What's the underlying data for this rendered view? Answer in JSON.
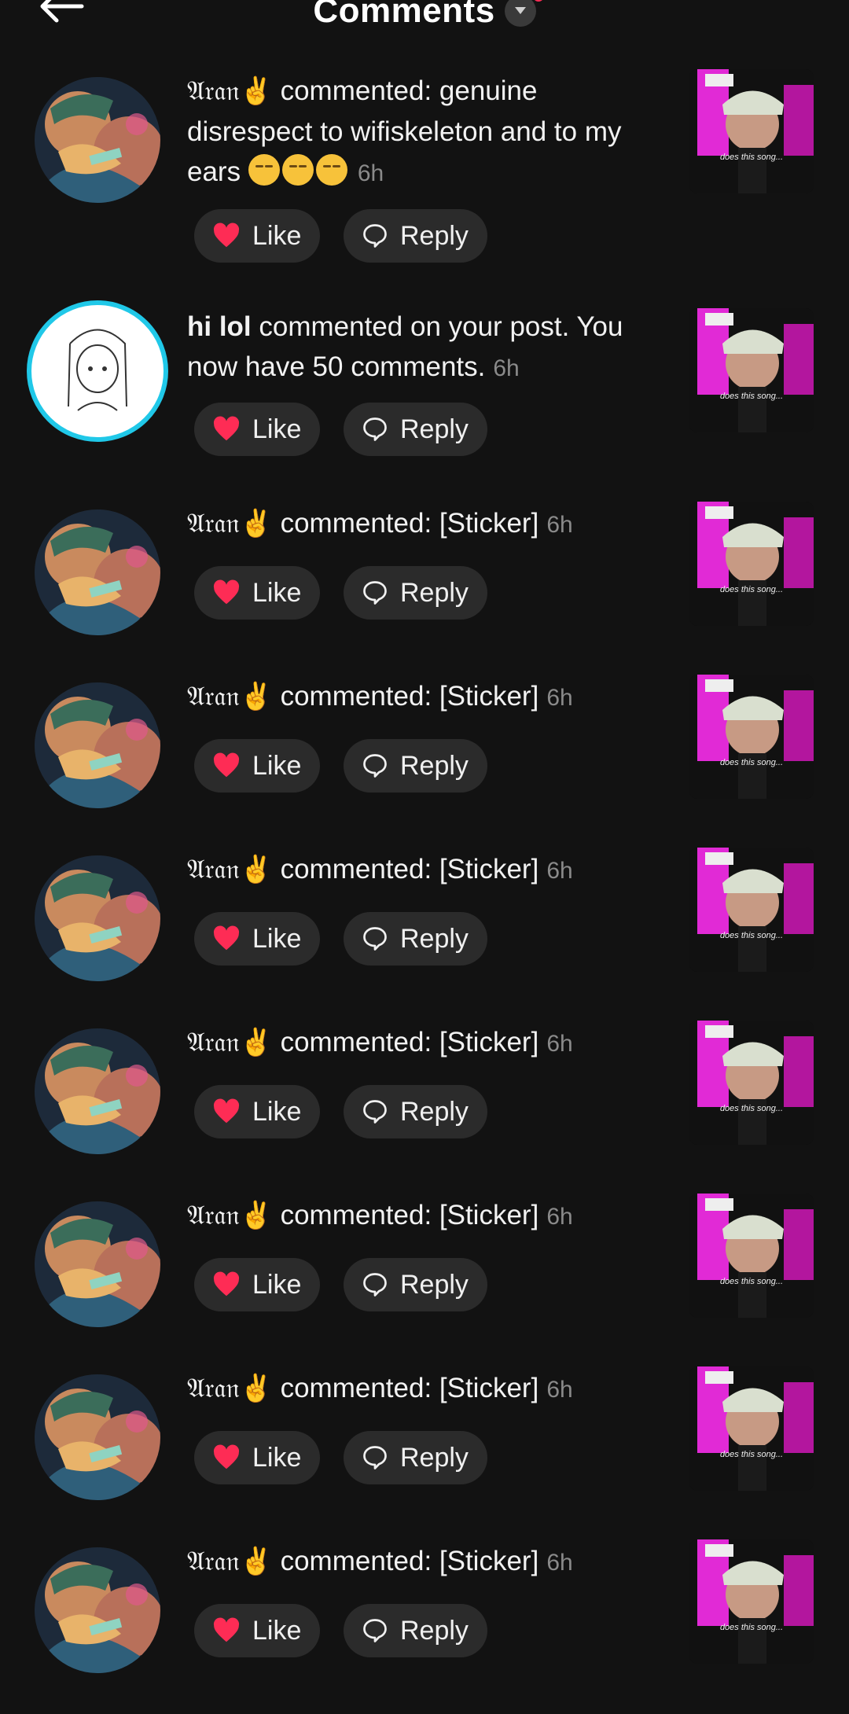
{
  "header": {
    "title": "Comments"
  },
  "colors": {
    "background": "#121212",
    "like_heart": "#fe2c55",
    "ring": "#20c8e8",
    "pill": "#2b2b2b",
    "timestamp": "#8a8a8a"
  },
  "icons": {
    "back": "back-arrow-icon",
    "dropdown": "chevron-down-icon",
    "like": "heart-icon",
    "reply": "speech-bubble-icon"
  },
  "actions": {
    "like_label": "Like",
    "reply_label": "Reply"
  },
  "thumbnail": {
    "caption": "does this song..."
  },
  "notifications": [
    {
      "user": "𝔄𝔯𝔞𝔫✌️",
      "text": "commented: genuine disrespect to wifiskeleton and to my ears",
      "emoji_count": 3,
      "time": "6h"
    },
    {
      "user": "hi lol",
      "text": "commented on your post. You now have 50 comments.",
      "time": "6h"
    },
    {
      "user": "𝔄𝔯𝔞𝔫✌️",
      "text": "commented: [Sticker]",
      "time": "6h"
    },
    {
      "user": "𝔄𝔯𝔞𝔫✌️",
      "text": "commented: [Sticker]",
      "time": "6h"
    },
    {
      "user": "𝔄𝔯𝔞𝔫✌️",
      "text": "commented: [Sticker]",
      "time": "6h"
    },
    {
      "user": "𝔄𝔯𝔞𝔫✌️",
      "text": "commented: [Sticker]",
      "time": "6h"
    },
    {
      "user": "𝔄𝔯𝔞𝔫✌️",
      "text": "commented: [Sticker]",
      "time": "6h"
    },
    {
      "user": "𝔄𝔯𝔞𝔫✌️",
      "text": "commented: [Sticker]",
      "time": "6h"
    },
    {
      "user": "𝔄𝔯𝔞𝔫✌️",
      "text": "commented: [Sticker]",
      "time": "6h"
    }
  ]
}
